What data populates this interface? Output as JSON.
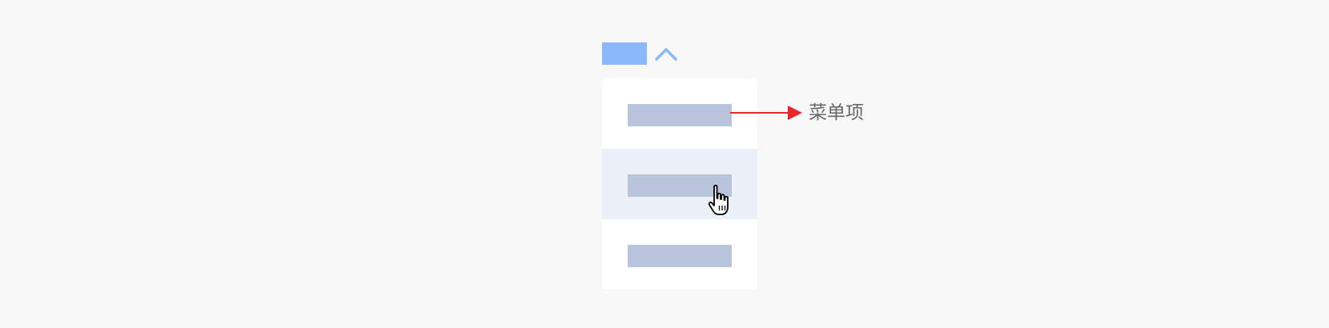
{
  "annotation": {
    "label": "菜单项"
  },
  "colors": {
    "trigger": "#8ab8fa",
    "chevron": "#8ab8fa",
    "menu_bg": "#ffffff",
    "hover_bg": "#ecf1f9",
    "item_placeholder": "#b8c4d9",
    "arrow": "#e8262b",
    "label_text": "#666666",
    "page_bg": "#f8f8f8"
  },
  "icons": {
    "chevron": "chevron-up-icon",
    "cursor": "hand-pointer-cursor-icon"
  },
  "menu": {
    "item_count": 3,
    "hovered_index": 1
  }
}
